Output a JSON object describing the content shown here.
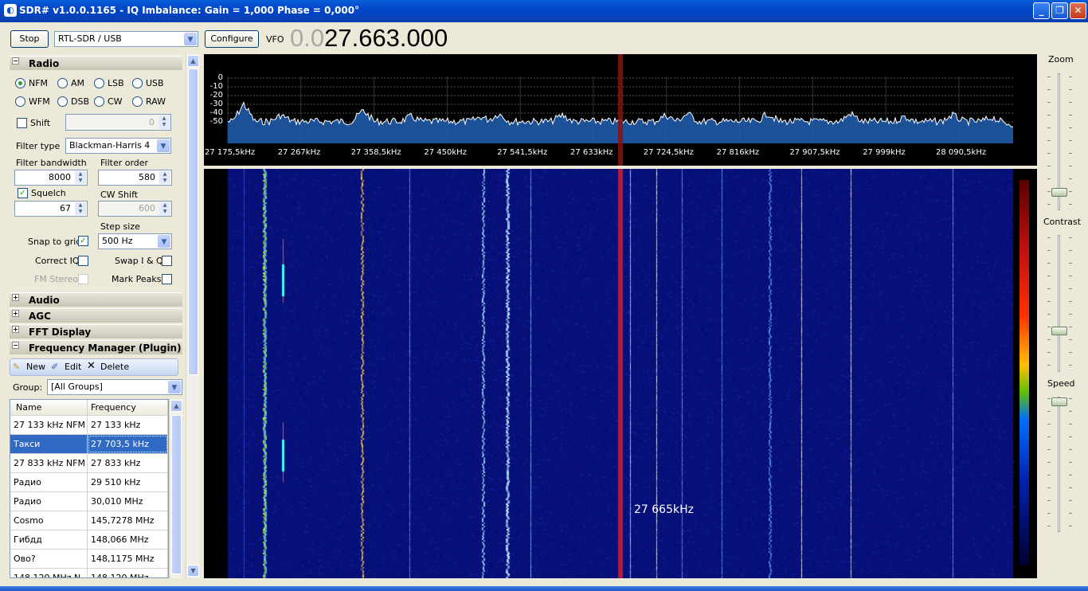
{
  "window": {
    "title": "SDR# v1.0.0.1165 - IQ Imbalance: Gain = 1,000 Phase = 0,000°",
    "min": "_",
    "max": "❐",
    "close": "✕"
  },
  "toolbar": {
    "stop": "Stop",
    "device": "RTL-SDR / USB",
    "configure": "Configure",
    "vfo_label": "VFO",
    "vfo_dim": "0.0",
    "vfo_value": "27.663.000"
  },
  "radio": {
    "title": "Radio",
    "modes": [
      "NFM",
      "AM",
      "LSB",
      "USB",
      "WFM",
      "DSB",
      "CW",
      "RAW"
    ],
    "selected_mode": "NFM",
    "shift_label": "Shift",
    "shift_value": "0",
    "filter_type_label": "Filter type",
    "filter_type": "Blackman-Harris 4",
    "filter_bw_label": "Filter bandwidth",
    "filter_bw": "8000",
    "filter_order_label": "Filter order",
    "filter_order": "580",
    "squelch_label": "Squelch",
    "squelch_value": "67",
    "cw_shift_label": "CW Shift",
    "cw_shift": "600",
    "step_size_label": "Step size",
    "step_size": "500 Hz",
    "snap_label": "Snap to grid",
    "correct_iq_label": "Correct IQ",
    "swap_iq_label": "Swap I & Q",
    "fm_stereo_label": "FM Stereo",
    "mark_peaks_label": "Mark Peaks"
  },
  "sections": {
    "audio": "Audio",
    "agc": "AGC",
    "fft": "FFT Display",
    "fm": "Frequency Manager (Plugin)"
  },
  "fm": {
    "new": "New",
    "edit": "Edit",
    "delete": "Delete",
    "group_label": "Group:",
    "group_value": "[All Groups]",
    "col_name": "Name",
    "col_freq": "Frequency",
    "rows": [
      {
        "name": "27 133 kHz NFM",
        "freq": "27 133 kHz"
      },
      {
        "name": "Такси",
        "freq": "27 703,5 kHz"
      },
      {
        "name": "27 833 kHz NFM",
        "freq": "27 833 kHz"
      },
      {
        "name": "Радио",
        "freq": "29 510 kHz"
      },
      {
        "name": "Радио",
        "freq": "30,010 MHz"
      },
      {
        "name": "Cosmo",
        "freq": "145,7278 MHz"
      },
      {
        "name": "Гибдд",
        "freq": "148,066 MHz"
      },
      {
        "name": "Ово?",
        "freq": "148,1175 MHz"
      },
      {
        "name": "148,120 MHz N",
        "freq": "148,120 MHz"
      }
    ],
    "selected_row": 1
  },
  "spectrum": {
    "y_ticks": [
      "0",
      "-10",
      "-20",
      "-30",
      "-40",
      "-50"
    ],
    "x_ticks": [
      "27 175,5kHz",
      "27 267kHz",
      "27 358,5kHz",
      "27 450kHz",
      "27 541,5kHz",
      "27 633kHz",
      "27 724,5kHz",
      "27 816kHz",
      "27 907,5kHz",
      "27 999kHz",
      "28 090,5kHz"
    ]
  },
  "waterfall": {
    "cursor_label": "27 665kHz"
  },
  "side": {
    "zoom": "Zoom",
    "contrast": "Contrast",
    "speed": "Speed"
  },
  "colors": {
    "accent": "#316ac5",
    "waterfall_bg": "#061078",
    "spectrum_fill": "#1f5aa8"
  }
}
